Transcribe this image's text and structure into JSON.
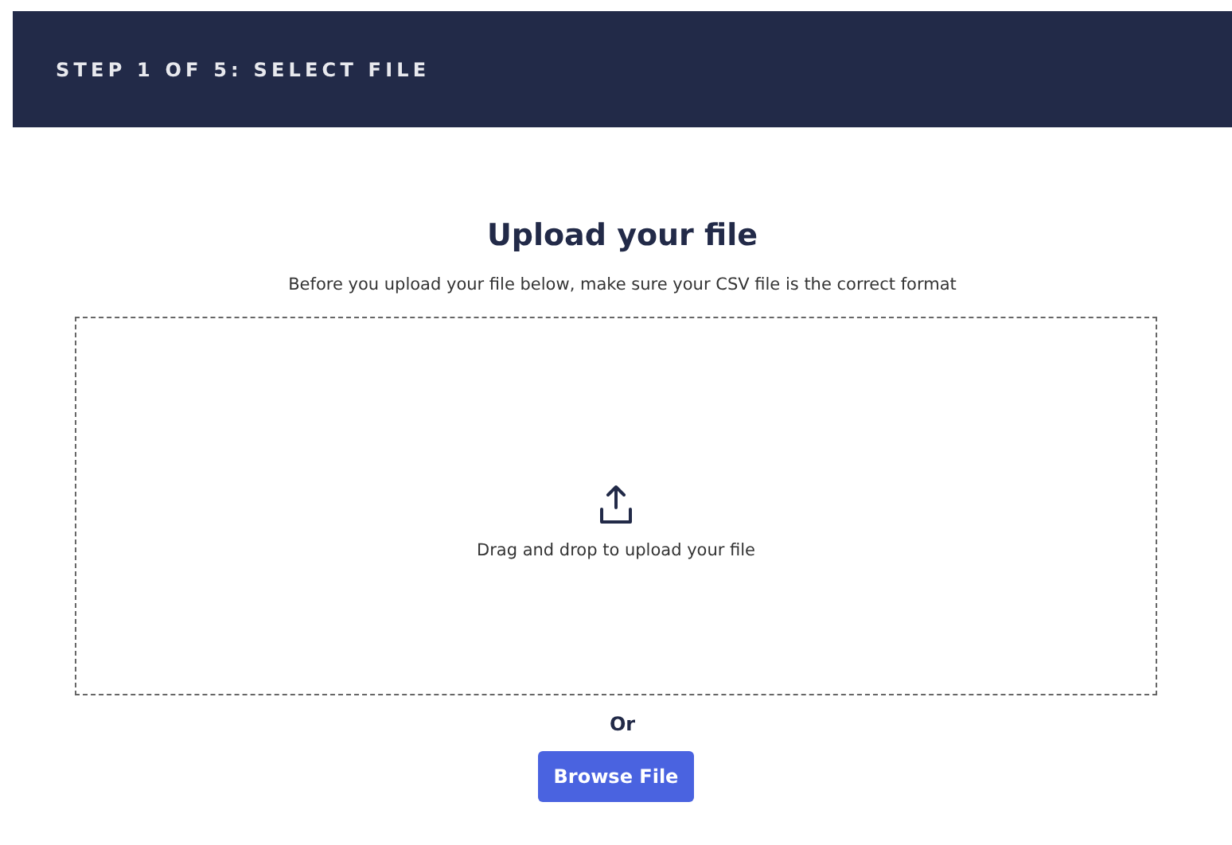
{
  "header": {
    "step": "STEP 1 OF 5: SELECT FILE"
  },
  "title": "Upload your file",
  "subtitle": "Before you upload your file below, make sure your CSV file is the correct format",
  "dropzone": {
    "text": "Drag and drop to upload your file"
  },
  "separator": "Or",
  "buttons": [
    "Browse File"
  ]
}
